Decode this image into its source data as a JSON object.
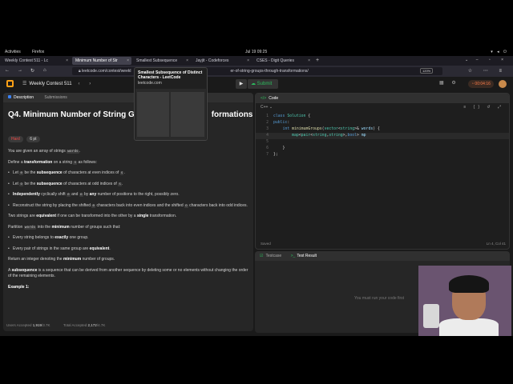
{
  "topbar": {
    "activities": "Activities",
    "app": "Firefox",
    "clock": "Jul 19  09:25"
  },
  "tabs": [
    {
      "label": "Weekly Contest 511 - Lc"
    },
    {
      "label": "Minimum Number of Str"
    },
    {
      "label": "Smallest Subsequence"
    },
    {
      "label": "Jayjit - Codeforces"
    },
    {
      "label": "CSES - Digit Queries"
    }
  ],
  "preview": {
    "title": "Smallest Subsequence of Distinct Characters - LeetCode",
    "url": "leetcode.com"
  },
  "url": {
    "left": "leetcode.com/contest/weekl",
    "right": "er-of-string-groups-through-transformations/",
    "zoom": "120%"
  },
  "header": {
    "contest": "Weekly Contest 511",
    "submit": "Submit",
    "timer": "00:04:16"
  },
  "left": {
    "tab_description": "Description",
    "tab_submissions": "Submissions",
    "title": "Q4. Minimum Number of String Gr",
    "title_end": "formations",
    "badge_hard": "Hard",
    "badge_points": "6 pt",
    "p1a": "You are given an array of strings",
    "c_words": "words",
    "p2a": "Define a",
    "p2b": "transformation",
    "p2c": "on a string",
    "c_s": "s",
    "p2d": "as follows:",
    "li1a": "Let",
    "c_e": "e",
    "li1b": "be the",
    "li_subseq": "subsequence",
    "li1c": "of characters at even indices of",
    "li2a": "Let",
    "c_o": "o",
    "li2b": "be the",
    "li2c": "of characters at odd indices of",
    "li3a": "Independently",
    "li3b": "cyclically shift",
    "li3c": "and",
    "li3d": "by",
    "li3e": "any",
    "li3f": "number of positions to the right, possibly zero.",
    "li4a": "Reconstruct the string by placing the shifted",
    "li4b": "characters back into even indices and the shifted",
    "li4c": "characters back into odd indices.",
    "p3a": "Two strings are",
    "p3b": "equivalent",
    "p3c": "if one can be transformed into the other by a",
    "p3d": "single",
    "p3e": "transformation.",
    "p4a": "Partition",
    "p4b": "into the",
    "p4c": "minimum",
    "p4d": "number of groups such that:",
    "li5a": "Every string belongs to",
    "li5b": "exactly",
    "li5c": "one group.",
    "li6a": "Every pair of strings in the same group are",
    "li6b": "equivalent",
    "p5a": "Return an integer denoting the",
    "p5b": "minimum",
    "p5c": "number of groups.",
    "p6a": "A",
    "p6b": "subsequence",
    "p6c": "is a sequence that can be derived from another sequence by deleting some or no elements without changing the order of the remaining elements.",
    "example": "Example 1:",
    "users_label": "Users Accepted",
    "users_val": "1,919",
    "users_total": "/3.7K",
    "total_label": "Total Accepted",
    "total_val": "2,172",
    "total_total": "/4.7K"
  },
  "code": {
    "header": "Code",
    "lang": "C++",
    "lines": [
      {
        "n": "1",
        "t": "class Solution {"
      },
      {
        "n": "2",
        "t": "public:"
      },
      {
        "n": "3",
        "t": "    int minimumGroups(vector<string>& words) {"
      },
      {
        "n": "4",
        "t": "        map<pair<string,string>,bool> mp"
      },
      {
        "n": "5",
        "t": ""
      },
      {
        "n": "6",
        "t": "    }"
      },
      {
        "n": "7",
        "t": "};"
      }
    ],
    "saved": "Saved",
    "cursor": "Ln 4, Col 41"
  },
  "test": {
    "testcase": "Testcase",
    "result": "Test Result",
    "message": "You must run your code first"
  }
}
